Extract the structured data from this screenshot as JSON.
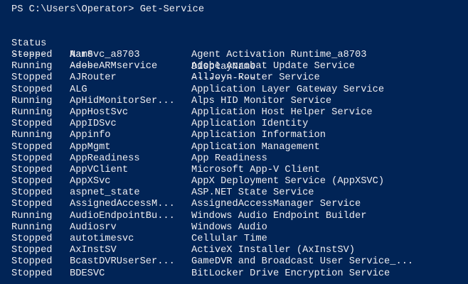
{
  "console": {
    "prompt": "PS C:\\Users\\Operator> Get-Service",
    "headers": {
      "status": "Status",
      "name": "Name",
      "display_name": "DisplayName"
    },
    "dashes": {
      "status": "------",
      "name": "----",
      "display_name": "-----------"
    },
    "rows": [
      {
        "status": "Stopped",
        "name": "AarSvc_a8703",
        "display_name": "Agent Activation Runtime_a8703"
      },
      {
        "status": "Running",
        "name": "AdobeARMservice",
        "display_name": "Adobe Acrobat Update Service"
      },
      {
        "status": "Stopped",
        "name": "AJRouter",
        "display_name": "AllJoyn Router Service"
      },
      {
        "status": "Stopped",
        "name": "ALG",
        "display_name": "Application Layer Gateway Service"
      },
      {
        "status": "Running",
        "name": "ApHidMonitorSer...",
        "display_name": "Alps HID Monitor Service"
      },
      {
        "status": "Running",
        "name": "AppHostSvc",
        "display_name": "Application Host Helper Service"
      },
      {
        "status": "Stopped",
        "name": "AppIDSvc",
        "display_name": "Application Identity"
      },
      {
        "status": "Running",
        "name": "Appinfo",
        "display_name": "Application Information"
      },
      {
        "status": "Stopped",
        "name": "AppMgmt",
        "display_name": "Application Management"
      },
      {
        "status": "Stopped",
        "name": "AppReadiness",
        "display_name": "App Readiness"
      },
      {
        "status": "Stopped",
        "name": "AppVClient",
        "display_name": "Microsoft App-V Client"
      },
      {
        "status": "Stopped",
        "name": "AppXSvc",
        "display_name": "AppX Deployment Service (AppXSVC)"
      },
      {
        "status": "Stopped",
        "name": "aspnet_state",
        "display_name": "ASP.NET State Service"
      },
      {
        "status": "Stopped",
        "name": "AssignedAccessM...",
        "display_name": "AssignedAccessManager Service"
      },
      {
        "status": "Running",
        "name": "AudioEndpointBu...",
        "display_name": "Windows Audio Endpoint Builder"
      },
      {
        "status": "Running",
        "name": "Audiosrv",
        "display_name": "Windows Audio"
      },
      {
        "status": "Stopped",
        "name": "autotimesvc",
        "display_name": "Cellular Time"
      },
      {
        "status": "Stopped",
        "name": "AxInstSV",
        "display_name": "ActiveX Installer (AxInstSV)"
      },
      {
        "status": "Stopped",
        "name": "BcastDVRUserSer...",
        "display_name": "GameDVR and Broadcast User Service_..."
      },
      {
        "status": "Stopped",
        "name": "BDESVC",
        "display_name": "BitLocker Drive Encryption Service"
      }
    ],
    "colors": {
      "background": "#012456",
      "text": "#eeedf0"
    }
  }
}
